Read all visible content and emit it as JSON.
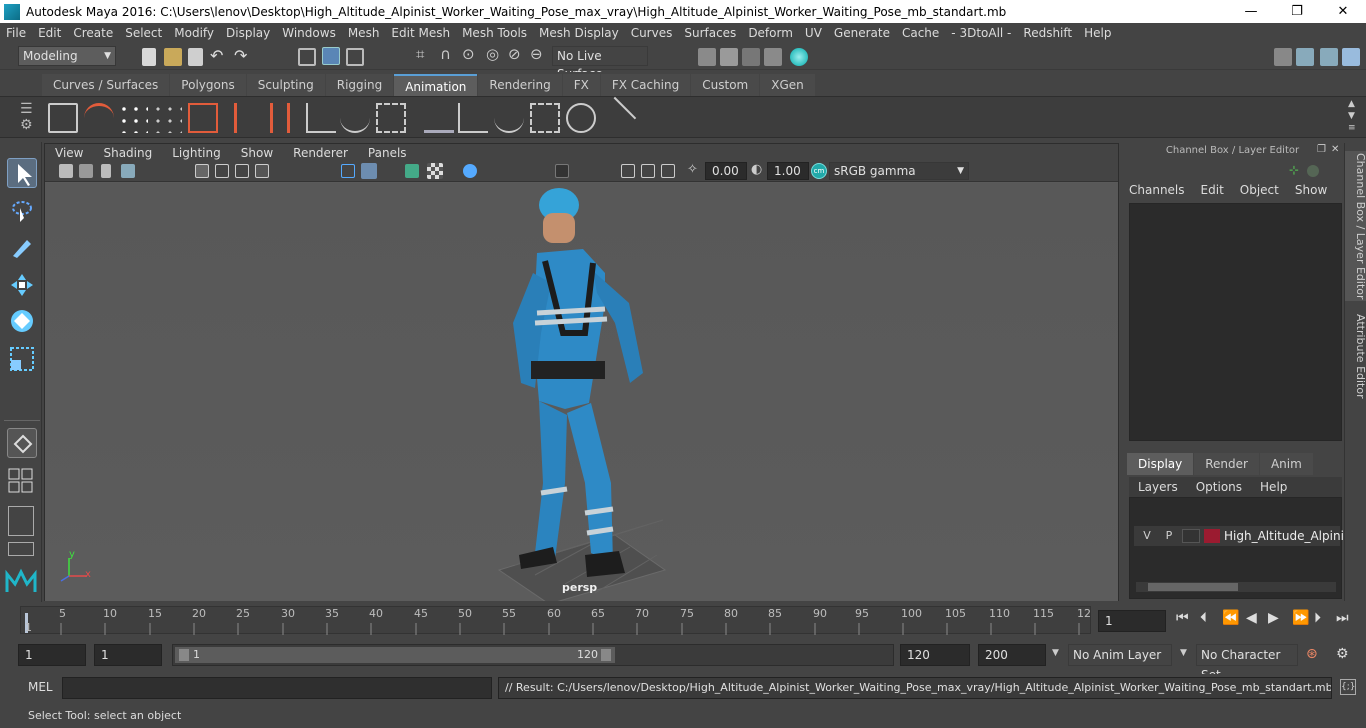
{
  "window": {
    "title": "Autodesk Maya 2016: C:\\Users\\lenov\\Desktop\\High_Altitude_Alpinist_Worker_Waiting_Pose_max_vray\\High_Altitude_Alpinist_Worker_Waiting_Pose_mb_standart.mb",
    "minimize": "—",
    "restore": "❐",
    "close": "✕"
  },
  "menubar": [
    "File",
    "Edit",
    "Create",
    "Select",
    "Modify",
    "Display",
    "Windows",
    "Mesh",
    "Edit Mesh",
    "Mesh Tools",
    "Mesh Display",
    "Curves",
    "Surfaces",
    "Deform",
    "UV",
    "Generate",
    "Cache",
    "- 3DtoAll -",
    "Redshift",
    "Help"
  ],
  "statusline": {
    "mode": "Modeling",
    "live_surface": "No Live Surface"
  },
  "shelf_tabs": [
    {
      "label": "Curves / Surfaces",
      "active": false
    },
    {
      "label": "Polygons",
      "active": false
    },
    {
      "label": "Sculpting",
      "active": false
    },
    {
      "label": "Rigging",
      "active": false
    },
    {
      "label": "Animation",
      "active": true
    },
    {
      "label": "Rendering",
      "active": false
    },
    {
      "label": "FX",
      "active": false
    },
    {
      "label": "FX Caching",
      "active": false
    },
    {
      "label": "Custom",
      "active": false
    },
    {
      "label": "XGen",
      "active": false
    }
  ],
  "viewport": {
    "menu": [
      "View",
      "Shading",
      "Lighting",
      "Show",
      "Renderer",
      "Panels"
    ],
    "exposure": "0.00",
    "gamma": "1.00",
    "color_space": "sRGB gamma",
    "camera_label": "persp",
    "axis_y": "y",
    "axis_x": "x"
  },
  "channel_box": {
    "header": "Channel Box / Layer Editor",
    "menu": [
      "Channels",
      "Edit",
      "Object",
      "Show"
    ]
  },
  "layer_editor": {
    "tabs": [
      {
        "label": "Display",
        "active": true
      },
      {
        "label": "Render",
        "active": false
      },
      {
        "label": "Anim",
        "active": false
      }
    ],
    "menu": [
      "Layers",
      "Options",
      "Help"
    ],
    "layer": {
      "v": "V",
      "p": "P",
      "name": "High_Altitude_Alpinist",
      "color": "#9b1b30"
    }
  },
  "side_tabs": [
    "Channel Box / Layer Editor",
    "Attribute Editor"
  ],
  "timeline": {
    "ticks": [
      "1",
      "5",
      "10",
      "15",
      "20",
      "25",
      "30",
      "35",
      "40",
      "45",
      "50",
      "55",
      "60",
      "65",
      "70",
      "75",
      "80",
      "85",
      "90",
      "95",
      "100",
      "105",
      "110",
      "115",
      "12"
    ],
    "current_frame": "1"
  },
  "range": {
    "start": "1",
    "playback_start": "1",
    "slider_start": "1",
    "slider_end": "120",
    "playback_end": "120",
    "end": "200",
    "anim_layer": "No Anim Layer",
    "character_set": "No Character Set"
  },
  "command": {
    "lang": "MEL",
    "result": "// Result: C:/Users/lenov/Desktop/High_Altitude_Alpinist_Worker_Waiting_Pose_max_vray/High_Altitude_Alpinist_Worker_Waiting_Pose_mb_standart.mb"
  },
  "help_line": "Select Tool: select an object",
  "colors": {
    "accent": "#5a9fd6",
    "suit": "#2e8ac6",
    "helmet": "#35a3d8"
  }
}
